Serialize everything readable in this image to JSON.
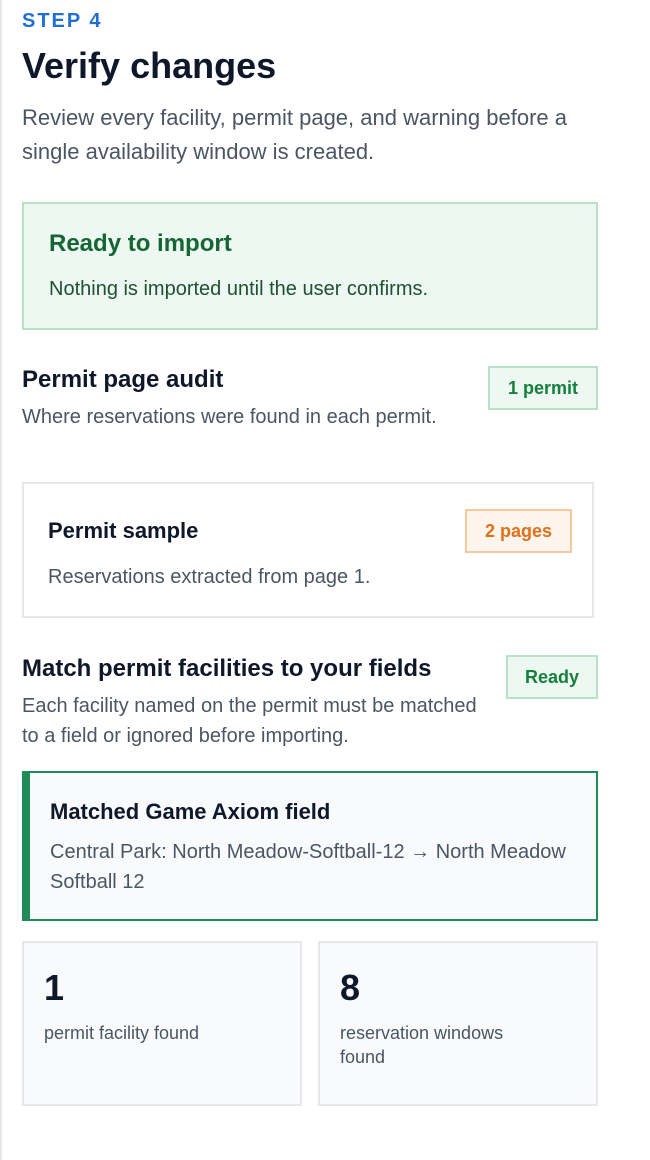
{
  "step": {
    "label": "STEP 4"
  },
  "header": {
    "title": "Verify changes",
    "description": "Review every facility, permit page, and warning before a single availability window is created."
  },
  "ready_notice": {
    "title": "Ready to import",
    "text": "Nothing is imported until the user confirms."
  },
  "permit_audit": {
    "title": "Permit page audit",
    "description": "Where reservations were found in each permit.",
    "badge": "1 permit",
    "card": {
      "title": "Permit sample",
      "badge": "2 pages",
      "text": "Reservations extracted from page 1."
    }
  },
  "facility_match": {
    "title": "Match permit facilities to your fields",
    "description": "Each facility named on the permit must be matched to a field or ignored before importing.",
    "badge": "Ready",
    "matched": {
      "title": "Matched Game Axiom field",
      "text": "Central Park: North Meadow-Softball-12 → North Meadow Softball 12"
    }
  },
  "stats": [
    {
      "value": "1",
      "label": "permit facility found"
    },
    {
      "value": "8",
      "label": "reservation windows found"
    }
  ],
  "colors": {
    "accent": "#1f6fd6",
    "success": "#15803d",
    "success_border": "#1f8a5a",
    "warning": "#e0701b"
  }
}
